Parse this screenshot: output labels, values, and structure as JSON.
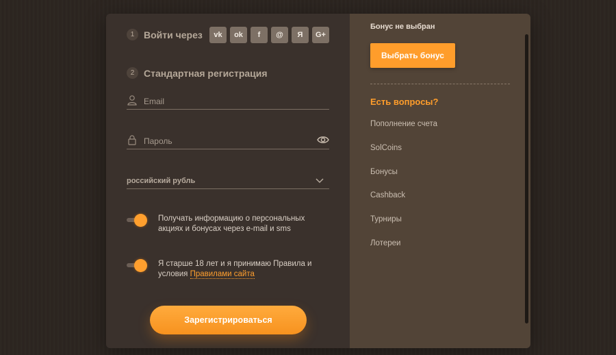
{
  "steps": [
    {
      "num": "1",
      "title": "Войти через"
    },
    {
      "num": "2",
      "title": "Стандартная регистрация"
    }
  ],
  "social": [
    {
      "name": "vk-icon",
      "glyph": "vk"
    },
    {
      "name": "odnoklassniki-icon",
      "glyph": "ok"
    },
    {
      "name": "facebook-icon",
      "glyph": "f"
    },
    {
      "name": "mail-ru-icon",
      "glyph": "@"
    },
    {
      "name": "yandex-icon",
      "glyph": "Я"
    },
    {
      "name": "google-plus-icon",
      "glyph": "G+"
    }
  ],
  "form": {
    "email_placeholder": "Email",
    "password_placeholder": "Пароль",
    "currency": "российский рубль"
  },
  "toggles": [
    {
      "text": "Получать информацию о персональных акциях и бонусах через e-mail и sms",
      "on": true
    },
    {
      "text_before": "Я старше 18 лет и я принимаю Правила и условия ",
      "link": "Правилами сайта",
      "on": true
    }
  ],
  "register_label": "Зарегистрироваться",
  "sidebar": {
    "bonus_status": "Бонус не выбран",
    "bonus_button": "Выбрать бонус",
    "faq_title": "Есть вопросы?",
    "faq_items": [
      "Пополнение счета",
      "SolCoins",
      "Бонусы",
      "Cashback",
      "Турниры",
      "Лотереи"
    ]
  },
  "colors": {
    "accent": "#ff9d2b",
    "left_panel": "#3a312c",
    "right_panel": "#524437",
    "background": "#2c2520"
  }
}
